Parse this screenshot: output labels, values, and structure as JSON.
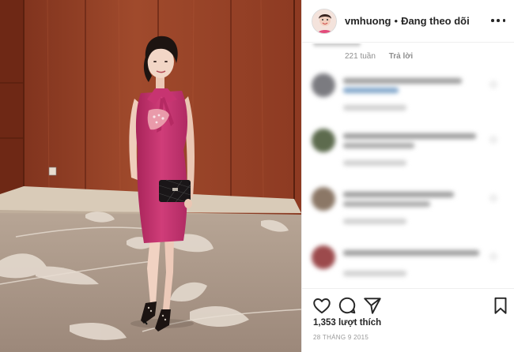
{
  "header": {
    "username": "vmhuong",
    "separator": "•",
    "follow_status": "Đang theo dõi"
  },
  "comments": {
    "top_meta": {
      "time": "221 tuần",
      "reply": "Trả lời"
    }
  },
  "footer": {
    "likes": "1,353 lượt thích",
    "date": "28 THÁNG 9 2015"
  },
  "icons": {
    "avatar": "profile-avatar",
    "more": "more-options-icon",
    "like": "heart-icon",
    "comment": "comment-icon",
    "share": "paper-plane-icon",
    "save": "bookmark-icon"
  },
  "colors": {
    "text": "#262626",
    "muted": "#8e8e8e",
    "dress": "#c4336e",
    "wall": "#8a3b23"
  }
}
